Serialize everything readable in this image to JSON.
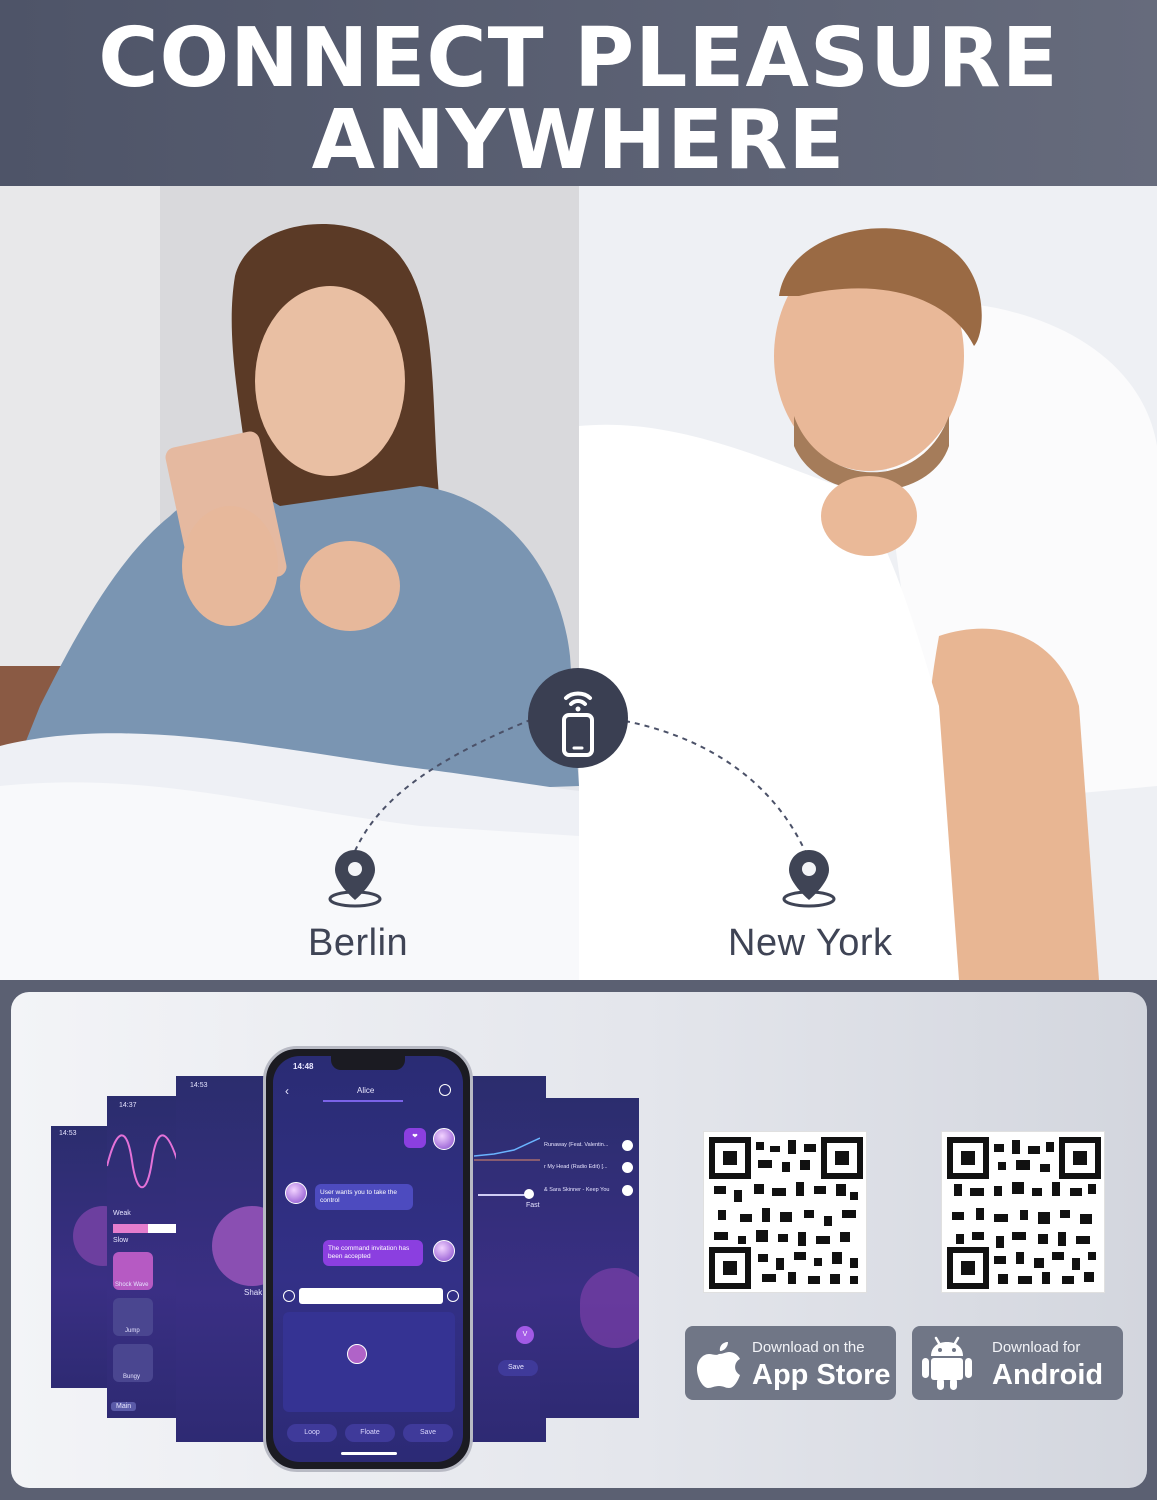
{
  "header": {
    "line1": "CONNECT PLEASURE",
    "line2": "ANYWHERE"
  },
  "locations": {
    "left_city": "Berlin",
    "right_city": "New York"
  },
  "phone": {
    "time": "14:48",
    "contact": "Alice",
    "messages": [
      {
        "text": "User wants you to take the control",
        "from": "user"
      },
      {
        "text": "The command invitation has been accepted",
        "from": "me"
      }
    ],
    "buttons": [
      "Loop",
      "Floate",
      "Save"
    ]
  },
  "back_screens": {
    "left1_time": "14:53",
    "left2_time": "14:37",
    "left3_time": "14:53",
    "left3_label": "Shak",
    "left2_labels": [
      "Weak",
      "Slow",
      "Shock Wave",
      "Jump",
      "Bungy",
      "Main"
    ],
    "right1_label": "Fast",
    "right1_save": "Save",
    "right2_songs": [
      "Runaway (Feat. Valentin...",
      "r My Head (Radio Edit) [...",
      "& Sara Skinner - Keep You"
    ]
  },
  "downloads": {
    "appstore_small": "Download on the",
    "appstore_big": "App Store",
    "android_small": "Download for",
    "android_big": "Android"
  },
  "colors": {
    "header_bg": "#555a6d",
    "panel_bg": "#eceef2",
    "app_purple": "#3a2f84",
    "store_button": "#707686"
  }
}
